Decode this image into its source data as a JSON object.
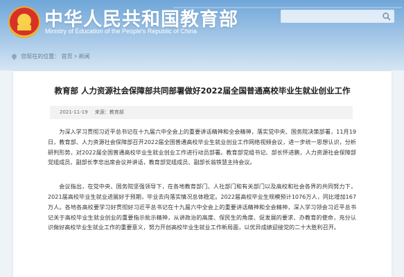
{
  "header": {
    "title": "中华人民共和国教育部",
    "subtitle": "Ministry of Education of the People's Republic of China",
    "search": {
      "placeholder": "",
      "icon": "search-icon"
    }
  },
  "breadcrumb": {
    "prefix": "您现在的位置：",
    "items": [
      "首页",
      "新闻"
    ],
    "separator": ">"
  },
  "article": {
    "title": "教育部 人力资源社会保障部共同部署做好2022届全国普通高校毕业生就业创业工作",
    "date": "2021-11-19",
    "source": "来源：教育部",
    "paragraphs": [
      "为深入学习贯彻习近平总书记在十九届六中全会上的重要讲话精神和全会精神，落实党中央、国务院决策部署，11月19日，教育部、人力资源社会保障部召开2022届全国普通高校毕业生就业创业工作网络视频会议，进一步统一思想认识，分析研判形势，对2022届全国普通高校毕业生就业创业工作进行动员部署。教育部党组书记、部长怀进鹏，人力资源社会保障部党组成员、副部长李忠出席会议并讲话，教育部党组成员、副部长翁铁慧主持会议。",
      "会议指出，在党中央、国务院坚强领导下，在各地教育部门、人社部门和有关部门以及高校和社会各界的共同努力下，2021届高校毕业生就业进展好于预期，毕业去向落实情况总体稳定。2022届高校毕业生规模预计1076万人，同比增加167万人。各地各高校要学习好贯彻好习近平总书记在十九届六中全会上的重要讲话精神和全会精神，深入学习领会习近平总书记关于高校毕业生就业创业的重要指示批示精神，从讲政治的高度、保民生的角度、促发展的要求、办教育的使命，充分认识做好高校毕业生就业工作的重要意义，努力开创高校毕业生就业工作新局面，以优异成绩迎接党的二十大胜利召开。"
    ]
  }
}
